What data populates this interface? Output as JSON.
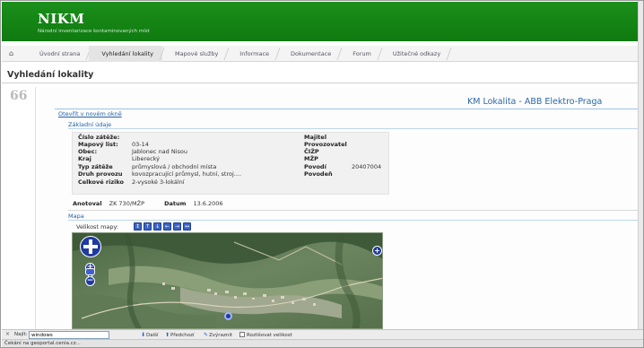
{
  "header": {
    "title": "NIKM",
    "subtitle": "Národní inventarizace kontaminovaných míst"
  },
  "nav": {
    "home_icon": "home-icon",
    "items": [
      {
        "label": "Úvodní strana"
      },
      {
        "label": "Vyhledání lokality"
      },
      {
        "label": "Mapové služby"
      },
      {
        "label": "Informace"
      },
      {
        "label": "Dokumentace"
      },
      {
        "label": "Forum"
      },
      {
        "label": "Užitečné odkazy"
      }
    ]
  },
  "page": {
    "title": "Vyhledání lokality",
    "quote": "66"
  },
  "locality": {
    "name": "KM Lokalita - ABB Elektro-Praga",
    "open_new_window": "Otevřít v novém okně",
    "basic_section": "Základní údaje",
    "left_fields": [
      {
        "label": "Číslo zátěže:",
        "value": ""
      },
      {
        "label": "Mapový list:",
        "value": "03-14"
      },
      {
        "label": "Obec:",
        "value": "Jablonec nad Nisou"
      },
      {
        "label": "Kraj",
        "value": "Liberecký"
      },
      {
        "label": "Typ zátěže",
        "value": "průmyslová / obchodní místa"
      },
      {
        "label": "Druh provozu",
        "value": "kovozpracující průmysl, hutní, stroj...."
      },
      {
        "label": "Celkové riziko",
        "value": "2-vysoké 3-lokální"
      }
    ],
    "right_fields": [
      {
        "label": "Majitel",
        "value": ""
      },
      {
        "label": "Provozovatel",
        "value": ""
      },
      {
        "label": "ČIŽP",
        "value": ""
      },
      {
        "label": "MŽP",
        "value": ""
      },
      {
        "label": "Povodí",
        "value": "20407004"
      },
      {
        "label": "Povodeň",
        "value": ""
      }
    ],
    "annotated_label": "Anotoval",
    "annotated_value": "ZK 730/MŽP",
    "date_label": "Datum",
    "date_value": "13.6.2006",
    "map_section": "Mapa",
    "map_size_label": "Velikost mapy:"
  },
  "findbar": {
    "close": "×",
    "label": "Najít:",
    "value": "windows",
    "next": "Další",
    "prev": "Předchozí",
    "highlight": "Zvýraznit",
    "match_case": "Rozlišovat velikost"
  },
  "status": {
    "text": "Čekání na geoportal.cenia.cz..."
  },
  "colors": {
    "header_green": "#128512",
    "link_blue": "#1f5fa8",
    "title_blue": "#2a68a8",
    "map_control_blue": "#1f3aa0"
  }
}
